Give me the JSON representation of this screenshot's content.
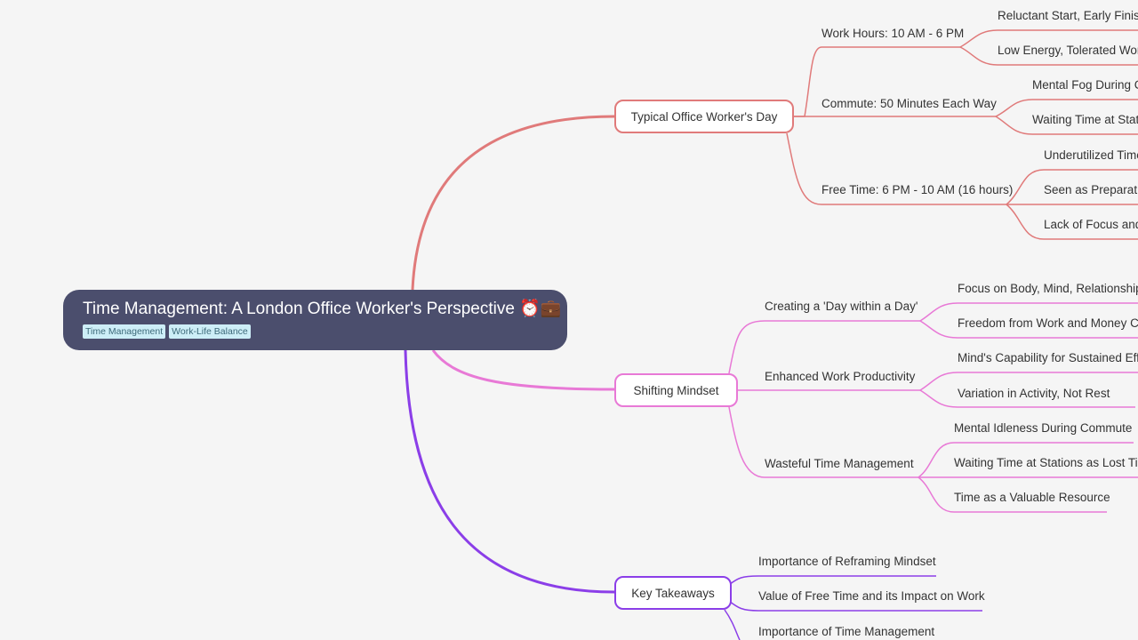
{
  "root": {
    "title": "Time Management: A London Office Worker's Perspective",
    "emoji": "⏰💼",
    "tags": [
      "Time Management",
      "Work-Life Balance"
    ]
  },
  "colors": {
    "background": "#f5f5f5",
    "root_fill": "#4b4e6d",
    "branch1": "#e07a7a",
    "branch2": "#e879d6",
    "branch3": "#8b3ee8"
  },
  "branches": [
    {
      "label": "Typical Office Worker's Day",
      "children": [
        {
          "label": "Work Hours: 10 AM - 6 PM",
          "children": [
            "Reluctant Start, Early Finish",
            "Low Energy, Tolerated Work"
          ]
        },
        {
          "label": "Commute: 50 Minutes Each Way",
          "children": [
            "Mental Fog During Commute",
            "Waiting Time at Stations"
          ]
        },
        {
          "label": "Free Time: 6 PM - 10 AM (16 hours)",
          "children": [
            "Underutilized Time",
            "Seen as Preparation",
            "Lack of Focus and"
          ]
        }
      ]
    },
    {
      "label": "Shifting Mindset",
      "children": [
        {
          "label": "Creating a 'Day within a Day'",
          "children": [
            "Focus on Body, Mind, Relationships",
            "Freedom from Work and Money Concerns"
          ]
        },
        {
          "label": "Enhanced Work Productivity",
          "children": [
            "Mind's Capability for Sustained Effort",
            "Variation in Activity, Not Rest"
          ]
        },
        {
          "label": "Wasteful Time Management",
          "children": [
            "Mental Idleness During Commute",
            "Waiting Time at Stations as Lost Time",
            "Time as a Valuable Resource"
          ]
        }
      ]
    },
    {
      "label": "Key Takeaways",
      "children": [
        {
          "label": "Importance of Reframing Mindset",
          "children": []
        },
        {
          "label": "Value of Free Time and its Impact on Work",
          "children": []
        },
        {
          "label": "Importance of Time Management",
          "children": []
        }
      ]
    }
  ]
}
